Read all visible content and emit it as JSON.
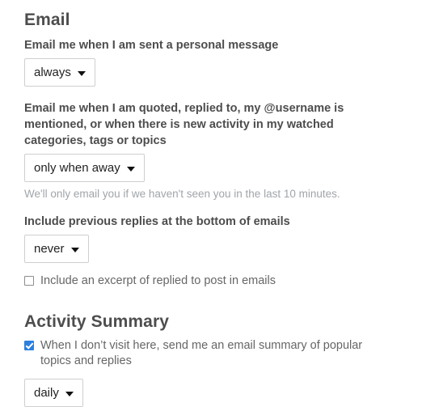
{
  "email_section": {
    "title": "Email",
    "personal_message": {
      "label": "Email me when I am sent a personal message",
      "select_value": "always"
    },
    "mentions": {
      "label": "Email me when I am quoted, replied to, my @username is mentioned, or when there is new activity in my watched categories, tags or topics",
      "select_value": "only when away",
      "helper_text": "We'll only email you if we haven't seen you in the last 10 minutes."
    },
    "previous_replies": {
      "label": "Include previous replies at the bottom of emails",
      "select_value": "never"
    },
    "excerpt_checkbox": {
      "label": "Include an excerpt of replied to post in emails",
      "checked": false
    }
  },
  "activity_summary_section": {
    "title": "Activity Summary",
    "summary_checkbox": {
      "label": "When I don’t visit here, send me an email summary of popular topics and replies",
      "checked": true
    },
    "frequency": {
      "select_value": "daily"
    }
  },
  "colors": {
    "heading": "#4d4d4d",
    "label": "#4d4d4d",
    "muted": "#a0a5aa",
    "body": "#666666",
    "accent": "#2b7fe0",
    "border": "#cfcfcf"
  }
}
